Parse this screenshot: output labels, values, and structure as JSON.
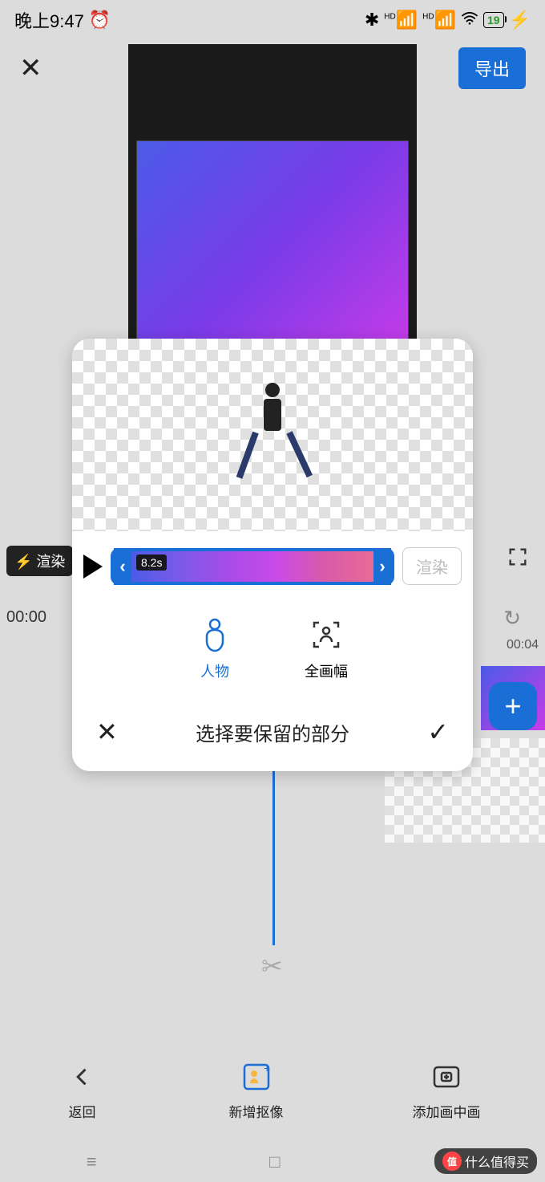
{
  "status": {
    "time": "晚上9:47",
    "battery": "19"
  },
  "header": {
    "export": "导出"
  },
  "bg": {
    "render_badge": "⚡ 渲染",
    "time_left": "00:00",
    "time_right": "00:04"
  },
  "dialog": {
    "duration": "8.2s",
    "render_button": "渲染",
    "option_person": "人物",
    "option_full": "全画幅",
    "title": "选择要保留的部分"
  },
  "toolbar": {
    "back": "返回",
    "cutout": "新增抠像",
    "pip": "添加画中画"
  },
  "watermark": {
    "badge": "值",
    "text": "什么值得买"
  }
}
